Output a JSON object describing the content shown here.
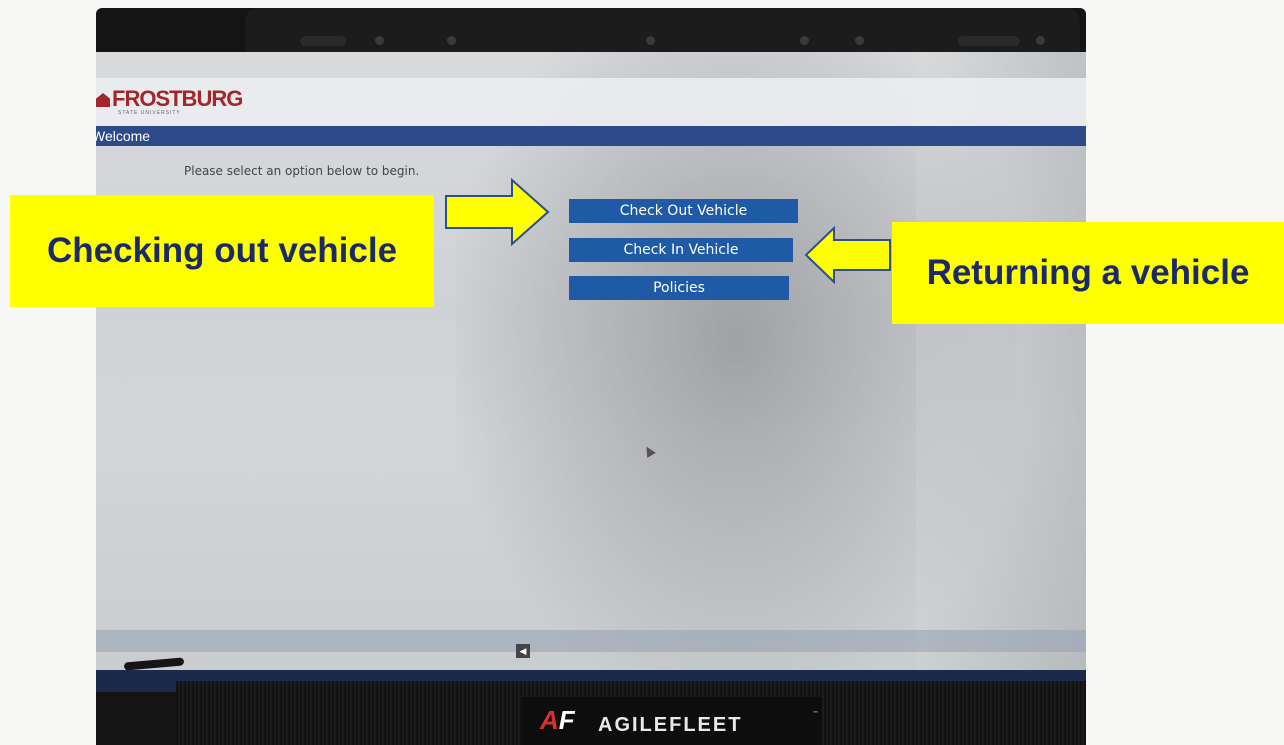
{
  "app": {
    "logo_text": "FROSTBURG",
    "logo_subtext": "STATE UNIVERSITY",
    "section_title": "Welcome",
    "instruction": "Please select an option below to begin."
  },
  "menu": {
    "check_out_label": "Check Out Vehicle",
    "check_in_label": "Check In Vehicle",
    "policies_label": "Policies"
  },
  "footer": {
    "back_symbol": "◀",
    "brand_mark": "AF",
    "brand_name": "AGILEFLEET",
    "brand_tm": "™"
  },
  "annotations": {
    "left_callout": "Checking out vehicle",
    "right_callout": "Returning a vehicle",
    "highlight_color": "#ffff00",
    "text_color": "#1a2a66"
  },
  "colors": {
    "header_bar": "#2d4b8a",
    "button": "#1f5aa6",
    "logo": "#a3262a"
  }
}
